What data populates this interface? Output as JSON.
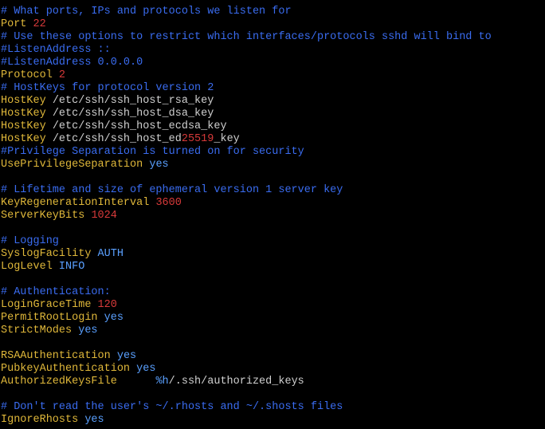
{
  "colors": {
    "background": "#000000",
    "comment": "#3a6cf0",
    "keyword": "#e0b83a",
    "value_number": "#d83a3a",
    "value_word": "#5aa0ff",
    "plain": "#d0d0d0"
  },
  "terminal": {
    "lines": [
      [
        {
          "text": "# What ports, IPs and protocols we listen for",
          "role": "comment"
        }
      ],
      [
        {
          "text": "Port",
          "role": "keyword"
        },
        {
          "text": " ",
          "role": "plain"
        },
        {
          "text": "22",
          "role": "value_number"
        }
      ],
      [
        {
          "text": "# Use these options to restrict which interfaces/protocols sshd will bind to",
          "role": "comment"
        }
      ],
      [
        {
          "text": "#ListenAddress ::",
          "role": "comment"
        }
      ],
      [
        {
          "text": "#ListenAddress 0.0.0.0",
          "role": "comment"
        }
      ],
      [
        {
          "text": "Protocol",
          "role": "keyword"
        },
        {
          "text": " ",
          "role": "plain"
        },
        {
          "text": "2",
          "role": "value_number"
        }
      ],
      [
        {
          "text": "# HostKeys for protocol version 2",
          "role": "comment"
        }
      ],
      [
        {
          "text": "HostKey",
          "role": "keyword"
        },
        {
          "text": " /etc/ssh/ssh_host_rsa_key",
          "role": "plain"
        }
      ],
      [
        {
          "text": "HostKey",
          "role": "keyword"
        },
        {
          "text": " /etc/ssh/ssh_host_dsa_key",
          "role": "plain"
        }
      ],
      [
        {
          "text": "HostKey",
          "role": "keyword"
        },
        {
          "text": " /etc/ssh/ssh_host_ecdsa_key",
          "role": "plain"
        }
      ],
      [
        {
          "text": "HostKey",
          "role": "keyword"
        },
        {
          "text": " /etc/ssh/ssh_host_ed",
          "role": "plain"
        },
        {
          "text": "25519",
          "role": "value_number"
        },
        {
          "text": "_key",
          "role": "plain"
        }
      ],
      [
        {
          "text": "#Privilege Separation is turned on for security",
          "role": "comment"
        }
      ],
      [
        {
          "text": "UsePrivilegeSeparation",
          "role": "keyword"
        },
        {
          "text": " ",
          "role": "plain"
        },
        {
          "text": "yes",
          "role": "value_word"
        }
      ],
      [],
      [
        {
          "text": "# Lifetime and size of ephemeral version 1 server key",
          "role": "comment"
        }
      ],
      [
        {
          "text": "KeyRegenerationInterval",
          "role": "keyword"
        },
        {
          "text": " ",
          "role": "plain"
        },
        {
          "text": "3600",
          "role": "value_number"
        }
      ],
      [
        {
          "text": "ServerKeyBits",
          "role": "keyword"
        },
        {
          "text": " ",
          "role": "plain"
        },
        {
          "text": "1024",
          "role": "value_number"
        }
      ],
      [],
      [
        {
          "text": "# Logging",
          "role": "comment"
        }
      ],
      [
        {
          "text": "SyslogFacility",
          "role": "keyword"
        },
        {
          "text": " ",
          "role": "plain"
        },
        {
          "text": "AUTH",
          "role": "value_word"
        }
      ],
      [
        {
          "text": "LogLevel",
          "role": "keyword"
        },
        {
          "text": " ",
          "role": "plain"
        },
        {
          "text": "INFO",
          "role": "value_word"
        }
      ],
      [],
      [
        {
          "text": "# Authentication:",
          "role": "comment"
        }
      ],
      [
        {
          "text": "LoginGraceTime",
          "role": "keyword"
        },
        {
          "text": " ",
          "role": "plain"
        },
        {
          "text": "120",
          "role": "value_number"
        }
      ],
      [
        {
          "text": "PermitRootLogin",
          "role": "keyword"
        },
        {
          "text": " ",
          "role": "plain"
        },
        {
          "text": "yes",
          "role": "value_word"
        }
      ],
      [
        {
          "text": "StrictModes",
          "role": "keyword"
        },
        {
          "text": " ",
          "role": "plain"
        },
        {
          "text": "yes",
          "role": "value_word"
        }
      ],
      [],
      [
        {
          "text": "RSAAuthentication",
          "role": "keyword"
        },
        {
          "text": " ",
          "role": "plain"
        },
        {
          "text": "yes",
          "role": "value_word"
        }
      ],
      [
        {
          "text": "PubkeyAuthentication",
          "role": "keyword"
        },
        {
          "text": " ",
          "role": "plain"
        },
        {
          "text": "yes",
          "role": "value_word"
        }
      ],
      [
        {
          "text": "AuthorizedKeysFile",
          "role": "keyword"
        },
        {
          "text": "      ",
          "role": "plain"
        },
        {
          "text": "%h",
          "role": "value_word"
        },
        {
          "text": "/.ssh/authorized_keys",
          "role": "plain"
        }
      ],
      [],
      [
        {
          "text": "# Don't read the user's ~/.rhosts and ~/.shosts files",
          "role": "comment"
        }
      ],
      [
        {
          "text": "IgnoreRhosts",
          "role": "keyword"
        },
        {
          "text": " ",
          "role": "plain"
        },
        {
          "text": "yes",
          "role": "value_word"
        }
      ]
    ]
  }
}
